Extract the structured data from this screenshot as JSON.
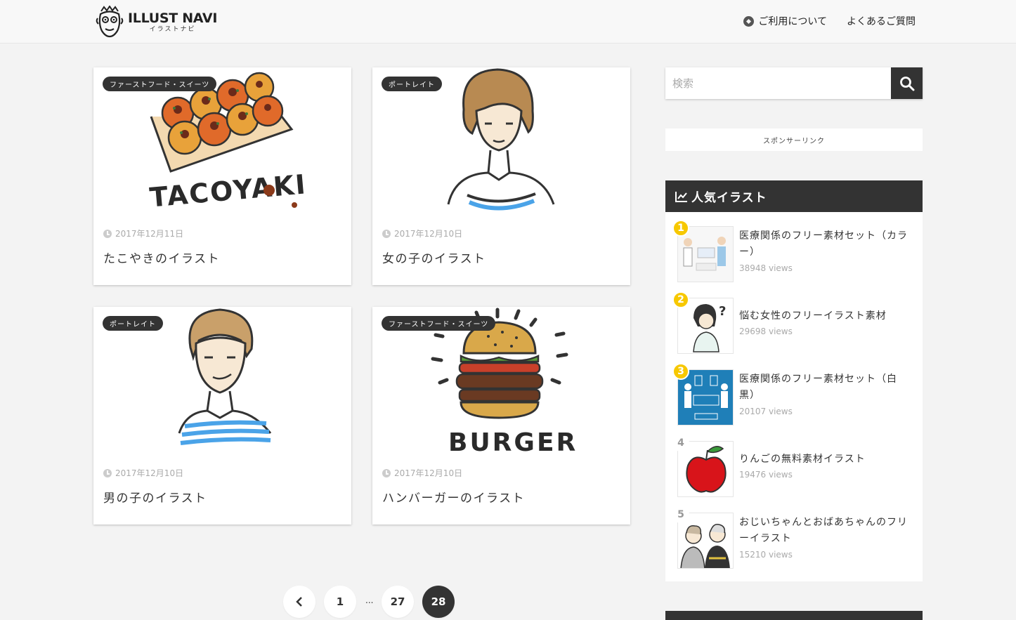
{
  "header": {
    "logo_title": "ILLUST NAVI",
    "logo_sub": "イラストナビ",
    "nav": [
      {
        "label": "ご利用について",
        "icon": "compass-icon"
      },
      {
        "label": "よくあるご質問"
      }
    ]
  },
  "cards": [
    {
      "category": "ファーストフード・スイーツ",
      "date": "2017年12月11日",
      "title": "たこやきのイラスト"
    },
    {
      "category": "ポートレイト",
      "date": "2017年12月10日",
      "title": "女の子のイラスト"
    },
    {
      "category": "ポートレイト",
      "date": "2017年12月10日",
      "title": "男の子のイラスト"
    },
    {
      "category": "ファーストフード・スイーツ",
      "date": "2017年12月10日",
      "title": "ハンバーガーのイラスト"
    }
  ],
  "pagination": {
    "first": "1",
    "dots": "...",
    "prev_page": "27",
    "current": "28"
  },
  "sidebar": {
    "search_placeholder": "検索",
    "sponsor_label": "スポンサーリンク",
    "popular_title": "人気イラスト",
    "popular": [
      {
        "rank": "1",
        "title": "医療関係のフリー素材セット（カラー）",
        "views": "38948 views"
      },
      {
        "rank": "2",
        "title": "悩む女性のフリーイラスト素材",
        "views": "29698 views"
      },
      {
        "rank": "3",
        "title": "医療関係のフリー素材セット（白黒）",
        "views": "20107 views"
      },
      {
        "rank": "4",
        "title": "りんごの無料素材イラスト",
        "views": "19476 views"
      },
      {
        "rank": "5",
        "title": "おじいちゃんとおばあちゃんのフリーイラスト",
        "views": "15210 views"
      }
    ]
  },
  "colors": {
    "dark": "#333333",
    "rank_gold": "#f7c800",
    "stripe_blue": "#4aa3e8"
  }
}
